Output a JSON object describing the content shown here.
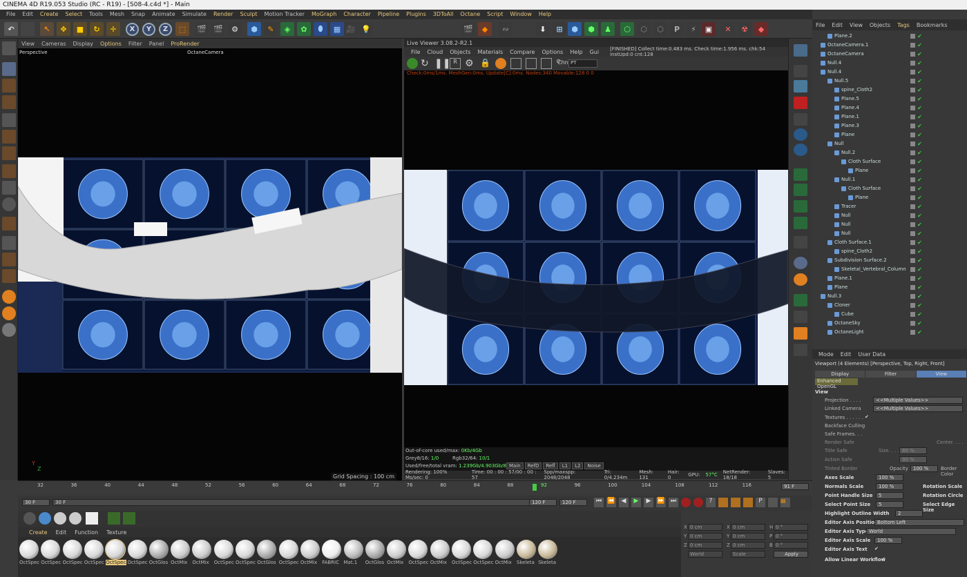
{
  "app": {
    "title": "CINEMA 4D R19.053 Studio (RC - R19) - [S08-4.c4d *] - Main"
  },
  "menubar": [
    "File",
    "Edit",
    "Create",
    "Select",
    "Tools",
    "Mesh",
    "Snap",
    "Animate",
    "Simulate",
    "Render",
    "Sculpt",
    "Motion Tracker",
    "MoGraph",
    "Character",
    "Pipeline",
    "Plugins",
    "3DToAll",
    "Octane",
    "Script",
    "Window",
    "Help"
  ],
  "toolbar": {
    "x": "X",
    "y": "Y",
    "z": "Z"
  },
  "viewport": {
    "menu": [
      "View",
      "Cameras",
      "Display",
      "Options",
      "Filter",
      "Panel",
      "ProRender"
    ],
    "label": "Perspective",
    "camera": "OctaneCamera",
    "grid_spacing": "Grid Spacing : 100 cm"
  },
  "live_viewer": {
    "title": "Live Viewer 3.08.2-R2.1",
    "menu": [
      "File",
      "Cloud",
      "Objects",
      "Materials",
      "Compare",
      "Options",
      "Help",
      "Gui"
    ],
    "status": "[FINISHED] Collect time:0.483 ms.  Check time:1.956 ms.  chk:54  instUpd:0  cnt:128",
    "chn_label": "Chn:",
    "chn_value": "PT",
    "check_line": "Check:0ms/1ms. MeshGen:0ms. Update[C]:0ms. Nodes:340 Movable:128  0 0",
    "out_of_core": "Out-of-core used/max:",
    "out_of_core_val": "0Kb/4Gb",
    "grey": "Grey8/16:",
    "grey_val": "1/0",
    "rgb": "Rgb32/64:",
    "rgb_val": "10/1",
    "vram": "Used/free/total vram:",
    "vram_val": "1.239Gb/4.903Gb/8Gb",
    "tabs": [
      "Main",
      "RefD",
      "Refl",
      "L1",
      "L2",
      "Noise"
    ],
    "render_line": [
      "Rendering: 100% Ms/sec: 0",
      "Time: 00 : 00 : 57/00 : 00 : 57",
      "Spp/maxspp: 2048/2048",
      "Tri: 0/4.234m",
      "Mesh: 131",
      "Hair: 0",
      "GPU:",
      "57°C",
      "NetRender: 18/18",
      "Slaves: 5"
    ]
  },
  "objmgr": {
    "menu": [
      "File",
      "Edit",
      "View",
      "Objects",
      "Tags",
      "Bookmarks"
    ],
    "rows": [
      {
        "name": "Plane.2",
        "indent": 1
      },
      {
        "name": "OctaneCamera.1",
        "indent": 0
      },
      {
        "name": "OctaneCamera",
        "indent": 0
      },
      {
        "name": "Null.4",
        "indent": 0
      },
      {
        "name": "Null.4",
        "indent": 0
      },
      {
        "name": "Null.5",
        "indent": 1
      },
      {
        "name": "spine_Cloth2",
        "indent": 2
      },
      {
        "name": "Plane.5",
        "indent": 2
      },
      {
        "name": "Plane.4",
        "indent": 2
      },
      {
        "name": "Plane.1",
        "indent": 2
      },
      {
        "name": "Plane.3",
        "indent": 2
      },
      {
        "name": "Plane",
        "indent": 2
      },
      {
        "name": "Null",
        "indent": 1
      },
      {
        "name": "Null.2",
        "indent": 2
      },
      {
        "name": "Cloth Surface",
        "indent": 3
      },
      {
        "name": "Plane",
        "indent": 4
      },
      {
        "name": "Null.1",
        "indent": 2
      },
      {
        "name": "Cloth Surface",
        "indent": 3
      },
      {
        "name": "Plane",
        "indent": 4
      },
      {
        "name": "Tracer",
        "indent": 2
      },
      {
        "name": "Null",
        "indent": 2
      },
      {
        "name": "Null",
        "indent": 2
      },
      {
        "name": "Null",
        "indent": 2
      },
      {
        "name": "Cloth Surface.1",
        "indent": 1
      },
      {
        "name": "spine_Cloth2",
        "indent": 2
      },
      {
        "name": "Subdivision Surface.2",
        "indent": 1
      },
      {
        "name": "Skeletal_Vertebral_Column",
        "indent": 2
      },
      {
        "name": "Plane.1",
        "indent": 1
      },
      {
        "name": "Plane",
        "indent": 1
      },
      {
        "name": "Null.3",
        "indent": 0
      },
      {
        "name": "Cloner",
        "indent": 1
      },
      {
        "name": "Cube",
        "indent": 2
      },
      {
        "name": "OctaneSky",
        "indent": 1
      },
      {
        "name": "OctaneLight",
        "indent": 1
      }
    ]
  },
  "attr": {
    "menu": [
      "Mode",
      "Edit",
      "User Data"
    ],
    "title": "Viewport (4 Elements) [Perspective, Top, Right, Front]",
    "tabs": [
      "Display",
      "Filter",
      "View"
    ],
    "subtab": "Enhanced OpenGL",
    "section": "View",
    "projection": "Projection . . . .",
    "projection_val": "<<Multiple Values>>",
    "linked_camera": "Linked Camera",
    "linked_camera_val": "<<Multiple Values>>",
    "textures": "Textures . . . . . .",
    "backface": "Backface Culling",
    "safe_frames": "Safe Frames. . .",
    "render_safe": "Render Safe",
    "title_safe": "Title Safe",
    "action_safe": "Action Safe",
    "tinted_border": "Tinted Border",
    "size": "Size. . . .",
    "size_val": "80 %",
    "size_val2": "90 %",
    "center": "Center. . . .",
    "opacity": "Opacity",
    "opacity_val": "100 %",
    "border_color": "Border Color",
    "axes_scale": "Axes Scale",
    "axes_scale_val": "100 %",
    "normals_scale": "Normals Scale",
    "normals_scale_val": "100 %",
    "rotation_scale": "Rotation Scale",
    "point_handle": "Point Handle Size",
    "point_handle_val": "5",
    "rotation_circle": "Rotation Circle",
    "select_point": "Select Point Size",
    "select_point_val": "5",
    "select_edge": "Select Edge Size",
    "highlight": "Highlight Outline Width",
    "highlight_val": "2",
    "editor_axis_pos": "Editor Axis Position",
    "editor_axis_pos_val": "Bottom Left",
    "editor_axis_type": "Editor Axis Type",
    "editor_axis_type_val": "World",
    "editor_axis_scale": "Editor Axis Scale",
    "editor_axis_scale_val": "100 %",
    "editor_axis_text": "Editor Axis Text",
    "linear_workflow": "Allow Linear Workflow"
  },
  "timeline": {
    "ticks": [
      "32",
      "36",
      "40",
      "44",
      "48",
      "52",
      "56",
      "60",
      "64",
      "68",
      "72",
      "76",
      "80",
      "84",
      "88",
      "92",
      "96",
      "100",
      "104",
      "108",
      "112",
      "116"
    ],
    "marker": "92",
    "end": "91 F",
    "start_field": "30 F",
    "start_field2": "30 F",
    "end_field": "120 F",
    "end_field2": "120 F"
  },
  "materials": {
    "menu": [
      "Create",
      "Edit",
      "Function",
      "Texture"
    ],
    "items": [
      "OctSpec",
      "OctSpec",
      "OctSpec",
      "OctSpec",
      "OctSpec",
      "OctSpec",
      "OctGlos",
      "OctMix",
      "OctMix",
      "OctSpec",
      "OctSpec",
      "OctGlos",
      "OctSpec",
      "OctMix",
      "FABRIC",
      "Mat.1",
      "OctGlos",
      "OctMix",
      "OctSpec",
      "OctMix",
      "OctSpec",
      "OctSpec",
      "OctMix",
      "Skeleta",
      "Skeleta"
    ]
  },
  "coords": {
    "x": "X",
    "y": "Y",
    "z": "Z",
    "h": "H",
    "p": "P",
    "b": "B",
    "zero_cm": "0 cm",
    "zero_deg": "0 °",
    "world": "World",
    "scale": "Scale",
    "apply": "Apply"
  },
  "colors": {
    "accent": "#e8c87c",
    "selected_tab": "#5a7fb5"
  }
}
